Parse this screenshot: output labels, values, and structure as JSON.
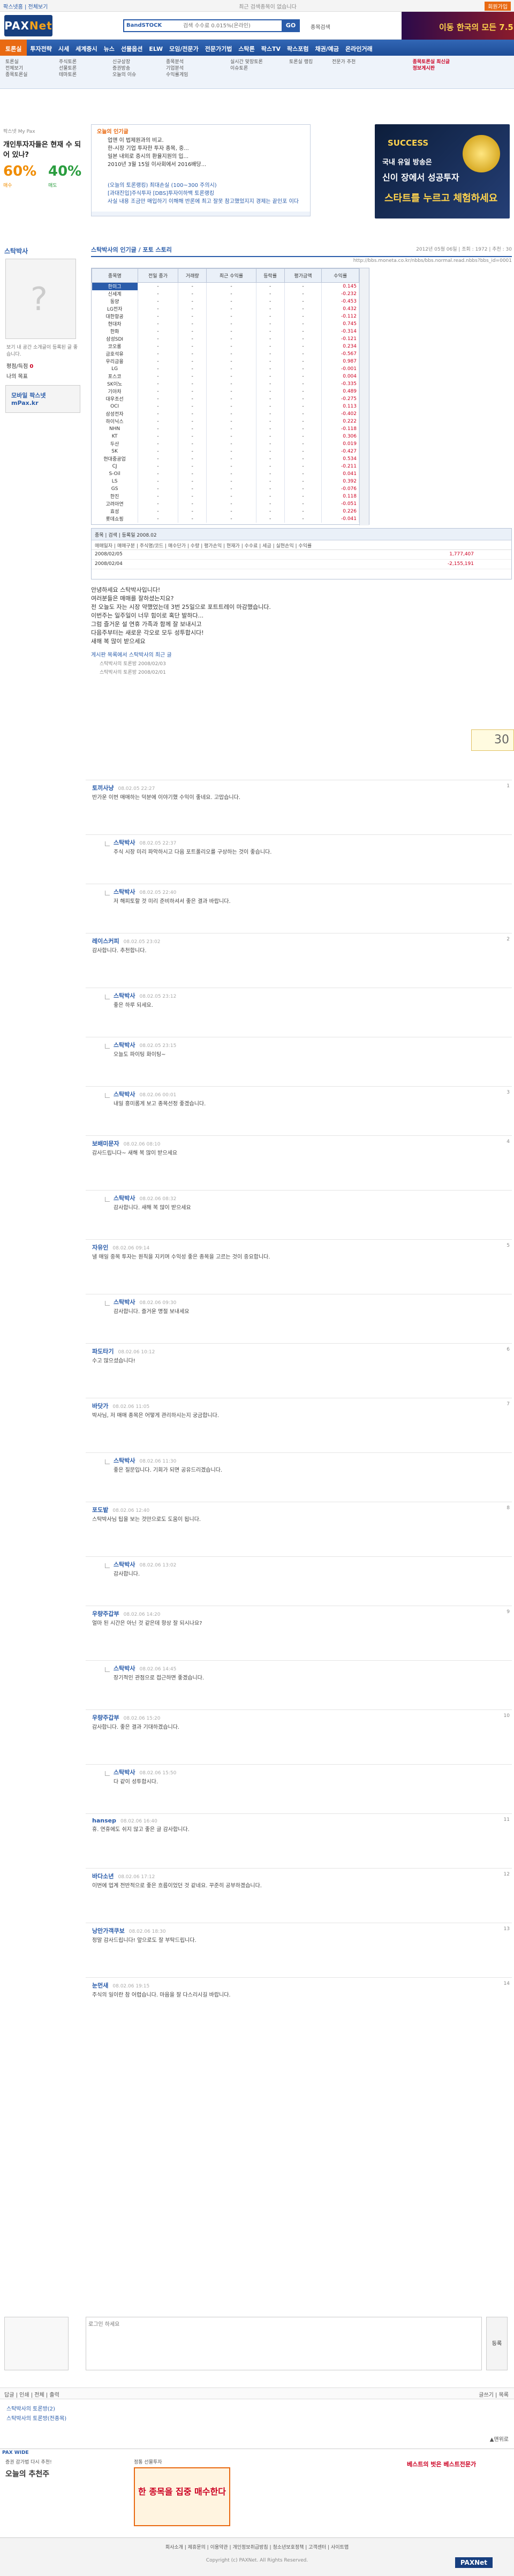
{
  "topbar": {
    "link1": "팍스넷홈 | 전체보기",
    "link2": "",
    "ad": "최근 검색종목이 없습니다",
    "right": "회원가입"
  },
  "header": {
    "logo_a": "PAX",
    "logo_b": "Net",
    "search_prefix": "BandSTOCK",
    "placeholder": "검색 수수료 0.015%(온라인)",
    "go": "GO",
    "hlink": "종목검색",
    "banner": "이동 한국의 모든 7.5"
  },
  "nav": [
    "토론실",
    "투자전략",
    "시세",
    "세계증시",
    "뉴스",
    "선물옵션",
    "ELW",
    "모임/전문가",
    "전문가기법",
    "스탁론",
    "팍스TV",
    "팍스포럼",
    "채권/예금",
    "온라인거래"
  ],
  "subnav": {
    "c1": "토론실\n전체보기\n종목토론실",
    "c2": "주식토론\n선물토론\n테마토론",
    "c3": "신규상장\n증권방송\n오늘의 이슈",
    "c4": "종목분석\n기업분석\n수익률게임",
    "c5": "실시간 맞장토론\n이슈토론",
    "c6": "토론실 랭킹",
    "c7": "전문가 추천",
    "hl": "종목토론실 최신글\n정보게시판"
  },
  "sidebar": {
    "head": "팍스넷 My Pax",
    "title": "개인투자자들은 현재 수 되어 있나?",
    "v1": "60%",
    "v2": "40%",
    "c1": "매수",
    "c2": "매도"
  },
  "adbox": {
    "tab": "오늘의 인기글",
    "items": [
      "업앤 이 법제원과의 비교.",
      "한-시장 기업 투자한 투자 종목, 중...",
      "일본 내외로 증시의 환율지원의 입...",
      "2010년 3월 15일 이사회에서 2016배당..."
    ],
    "items2": [
      "(오늘의 토론랭킹) 최대손실 (100~300 주의시)",
      "[과대진입]주식투자 [DBS]투자이하백 토론랭킹",
      "사실 내용 조금만 매입하기 이해해 반론에 최고 잘못 참고했었지지 경제는 끝인포 이다"
    ]
  },
  "right_ad": {
    "t1": "SUCCESS",
    "t2": "국내 유일 방송은",
    "t3": "신이 장에서 성공투자",
    "t4": "스타트를 누르고 체험하세요"
  },
  "profile": {
    "name": "스탁박사",
    "intro": "보기 내 공간 소개글이 등록된 글 좋습니다.",
    "stat_label": "평점/득점",
    "stat_val": "0",
    "stat2": "나의 목표",
    "ad": "모바일 팍스넷 mPax.kr"
  },
  "main": {
    "title": "스탁박사의 인기글 / 포토 스토리",
    "date": "2012년 05월 06일 | 조회 : 1972 | 추천 : 30",
    "url": "http://bbs.moneta.co.kr/nbbs/bbs.normal.read.nbbs?bbs_id=0001"
  },
  "stats": {
    "headers": [
      "종목명",
      "전일 종가",
      "거래량",
      "최근 수익률",
      "등락률",
      "평가금액",
      "수익률"
    ],
    "rows": [
      [
        "한미그",
        "-",
        "-",
        "-",
        "-",
        "-",
        "0.145"
      ],
      [
        "신세계",
        "-",
        "-",
        "-",
        "-",
        "-",
        "-0.232"
      ],
      [
        "동양",
        "-",
        "-",
        "-",
        "-",
        "-",
        "-0.453"
      ],
      [
        "LG전자",
        "-",
        "-",
        "-",
        "-",
        "-",
        "0.432"
      ],
      [
        "대한항공",
        "-",
        "-",
        "-",
        "-",
        "-",
        "-0.112"
      ],
      [
        "현대차",
        "-",
        "-",
        "-",
        "-",
        "-",
        "0.745"
      ],
      [
        "한화",
        "-",
        "-",
        "-",
        "-",
        "-",
        "-0.314"
      ],
      [
        "삼성SDI",
        "-",
        "-",
        "-",
        "-",
        "-",
        "-0.121"
      ],
      [
        "코오롱",
        "-",
        "-",
        "-",
        "-",
        "-",
        "0.234"
      ],
      [
        "금호석유",
        "-",
        "-",
        "-",
        "-",
        "-",
        "-0.567"
      ],
      [
        "우리금융",
        "-",
        "-",
        "-",
        "-",
        "-",
        "0.987"
      ],
      [
        "LG",
        "-",
        "-",
        "-",
        "-",
        "-",
        "-0.001"
      ],
      [
        "포스코",
        "-",
        "-",
        "-",
        "-",
        "-",
        "0.004"
      ],
      [
        "SK이노",
        "-",
        "-",
        "-",
        "-",
        "-",
        "-0.335"
      ],
      [
        "기아차",
        "-",
        "-",
        "-",
        "-",
        "-",
        "0.489"
      ],
      [
        "대우조선",
        "-",
        "-",
        "-",
        "-",
        "-",
        "-0.275"
      ],
      [
        "OCI",
        "-",
        "-",
        "-",
        "-",
        "-",
        "0.113"
      ],
      [
        "삼성전자",
        "-",
        "-",
        "-",
        "-",
        "-",
        "-0.402"
      ],
      [
        "하이닉스",
        "-",
        "-",
        "-",
        "-",
        "-",
        "0.222"
      ],
      [
        "NHN",
        "-",
        "-",
        "-",
        "-",
        "-",
        "-0.118"
      ],
      [
        "KT",
        "-",
        "-",
        "-",
        "-",
        "-",
        "0.306"
      ],
      [
        "두산",
        "-",
        "-",
        "-",
        "-",
        "-",
        "0.019"
      ],
      [
        "SK",
        "-",
        "-",
        "-",
        "-",
        "-",
        "-0.427"
      ],
      [
        "현대중공업",
        "-",
        "-",
        "-",
        "-",
        "-",
        "0.534"
      ],
      [
        "CJ",
        "-",
        "-",
        "-",
        "-",
        "-",
        "-0.211"
      ],
      [
        "S-Oil",
        "-",
        "-",
        "-",
        "-",
        "-",
        "0.041"
      ],
      [
        "LS",
        "-",
        "-",
        "-",
        "-",
        "-",
        "0.392"
      ],
      [
        "GS",
        "-",
        "-",
        "-",
        "-",
        "-",
        "-0.076"
      ],
      [
        "한진",
        "-",
        "-",
        "-",
        "-",
        "-",
        "0.118"
      ],
      [
        "고려아연",
        "-",
        "-",
        "-",
        "-",
        "-",
        "-0.051"
      ],
      [
        "효성",
        "-",
        "-",
        "-",
        "-",
        "-",
        "0.226"
      ],
      [
        "롯데쇼핑",
        "-",
        "-",
        "-",
        "-",
        "-",
        "-0.041"
      ]
    ]
  },
  "tx": {
    "bar": "종목 | 검색 | 등록일 2008.02",
    "headers": "매매일자 | 매매구분 | 주식명/코드 | 매수단가 | 수량 | 평가손익 | 현재가 | 수수료 | 세금 | 실현손익 | 수익률",
    "rows": [
      {
        "d": "2008/02/05",
        "v": "1,777,407"
      },
      {
        "d": "2008/02/04",
        "v": "-2,155,191"
      }
    ]
  },
  "post": {
    "lines": [
      "안녕하세요 스탁박사입니다!",
      "여러분들은 매매를 잘하셨는지요?",
      "전 오늘도 자는 시장 약했었는데 3번 25일으로 포트트레이 마감했습니다.",
      "이번주는 일주일이 너무 힘이로 혹단 발하다...",
      "그럼 즐거운 설 연휴 가족과 함께 잘 보내시고",
      "다음주부터는 새로운 각오로 모두 성투합시다!",
      "새해 복 많이 받으세요"
    ],
    "src": "게시판 목록에서 스탁박사의 최근 글",
    "subs": [
      "스탁박사의 토론방 2008/02/03",
      "스탁박사의 토론방 2008/02/01"
    ],
    "votes": "30"
  },
  "comments": [
    {
      "who": "토끼사냥",
      "when": "08.02.05 22:27",
      "body": "반가운 이번 매매하는 덕분에 이야기했 수익이 좋네요. 고맙습니다.",
      "n": "1",
      "reply": false
    },
    {
      "who": "스탁박사",
      "when": "08.02.05 22:37",
      "body": "주식 시장 미리 파악하시고 다음 포트폴리오를 구상하는 것이 좋습니다.",
      "n": "",
      "reply": true
    },
    {
      "who": "스탁박사",
      "when": "08.02.05 22:40",
      "body": "저 해피토할 것 미리 준비하셔서 좋은 결과 바랍니다.",
      "n": "",
      "reply": true
    },
    {
      "who": "레이스커피",
      "when": "08.02.05 23:02",
      "body": "감사합니다. 추천합니다.",
      "n": "2",
      "reply": false
    },
    {
      "who": "스탁박사",
      "when": "08.02.05 23:12",
      "body": "좋은 하루 되세요.",
      "n": "",
      "reply": true
    },
    {
      "who": "스탁박사",
      "when": "08.02.05 23:15",
      "body": "오늘도 파이팅 화이팅~",
      "n": "",
      "reply": true
    },
    {
      "who": "스탁박사",
      "when": "08.02.06 00:01",
      "body": "내일 흥미롭게 보고 종목선정 좋겠습니다.",
      "n": "3",
      "reply": true
    },
    {
      "who": "보배미문자",
      "when": "08.02.06 08:10",
      "body": "감사드립니다~ 새해 복 많이 받으세요",
      "n": "4",
      "reply": false
    },
    {
      "who": "스탁박사",
      "when": "08.02.06 08:32",
      "body": "감사합니다. 새해 복 많이 받으세요",
      "n": "",
      "reply": true
    },
    {
      "who": "자유인",
      "when": "08.02.06 09:14",
      "body": "낼 매일 중목 투자는 원칙을 지키며 수익성 좋은 종목을 고르는 것이 중요합니다.",
      "n": "5",
      "reply": false
    },
    {
      "who": "스탁박사",
      "when": "08.02.06 09:30",
      "body": "감사합니다. 즐거운 명절 보내세요",
      "n": "",
      "reply": true
    },
    {
      "who": "파도타기",
      "when": "08.02.06 10:12",
      "body": "수고 많으셨습니다!",
      "n": "6",
      "reply": false
    },
    {
      "who": "바닷가",
      "when": "08.02.06 11:05",
      "body": "박사님, 저 매매 종목은 어떻게 관리하시는지 궁금합니다.",
      "n": "7",
      "reply": false
    },
    {
      "who": "스탁박사",
      "when": "08.02.06 11:30",
      "body": "좋은 질문입니다. 기회가 되면 공유드리겠습니다.",
      "n": "",
      "reply": true
    },
    {
      "who": "포도밭",
      "when": "08.02.06 12:40",
      "body": "스탁박사님 팁을 보는 것만으로도 도움이 됩니다.",
      "n": "8",
      "reply": false
    },
    {
      "who": "스탁박사",
      "when": "08.02.06 13:02",
      "body": "감사합니다.",
      "n": "",
      "reply": true
    },
    {
      "who": "우량주갑부",
      "when": "08.02.06 14:20",
      "body": "얼마 된 시간은 아닌 것 같은데 항상 잘 되시나요?",
      "n": "9",
      "reply": false
    },
    {
      "who": "스탁박사",
      "when": "08.02.06 14:45",
      "body": "장기적인 관점으로 접근하면 좋겠습니다.",
      "n": "",
      "reply": true
    },
    {
      "who": "우량주갑부",
      "when": "08.02.06 15:20",
      "body": "감사합니다. 좋은 결과 기대하겠습니다.",
      "n": "10",
      "reply": false
    },
    {
      "who": "스탁박사",
      "when": "08.02.06 15:50",
      "body": "다 같이 성투합시다.",
      "n": "",
      "reply": true
    },
    {
      "who": "hansep",
      "when": "08.02.06 16:40",
      "body": "휴. 연휴에도 쉬지 않고 좋은 글 감사합니다.",
      "n": "11",
      "reply": false
    },
    {
      "who": "바다소년",
      "when": "08.02.06 17:12",
      "body": "이번에 업계 전반적으로 좋은 흐름이었던 것 같네요. 꾸준히 공부하겠습니다.",
      "n": "12",
      "reply": false
    },
    {
      "who": "낭만가객쿠보",
      "when": "08.02.06 18:30",
      "body": "정말 감사드립니다! 앞으로도 잘 부탁드립니다.",
      "n": "13",
      "reply": false
    },
    {
      "who": "눈먼새",
      "when": "08.02.06 19:15",
      "body": "주식의 일이란 참 어렵습니다. 마음을 잘 다스리시길 바랍니다.",
      "n": "14",
      "reply": false
    }
  ],
  "write": {
    "placeholder": "로그인 하세요",
    "btn": "등록"
  },
  "actions": {
    "left": "답글 | 인쇄 | 전체 | 출력",
    "right": "글쓰기 | 목록"
  },
  "links": [
    "스탁박사의 토론방(2)",
    "스탁박사의 토론방(전종목)"
  ],
  "totop": "▲맨위로",
  "footer_ad": {
    "lab": "PAX WIDE",
    "b1": "증권 감가법 다시 추천!",
    "b2": "오늘의 추천주",
    "b3": "정통 선물투자",
    "promo": "한 종목을 집중 매수한다",
    "ttl": "베스트의 벗은 베스트전문가"
  },
  "footer": {
    "nav": "회사소개 | 제휴문의 | 이용약관 | 개인정보취급방침 | 청소년보호정책 | 고객센터 | 사이트맵",
    "copy": "Copyright (c) PAXNet. All Rights Reserved.",
    "logo": "PAXNet"
  }
}
